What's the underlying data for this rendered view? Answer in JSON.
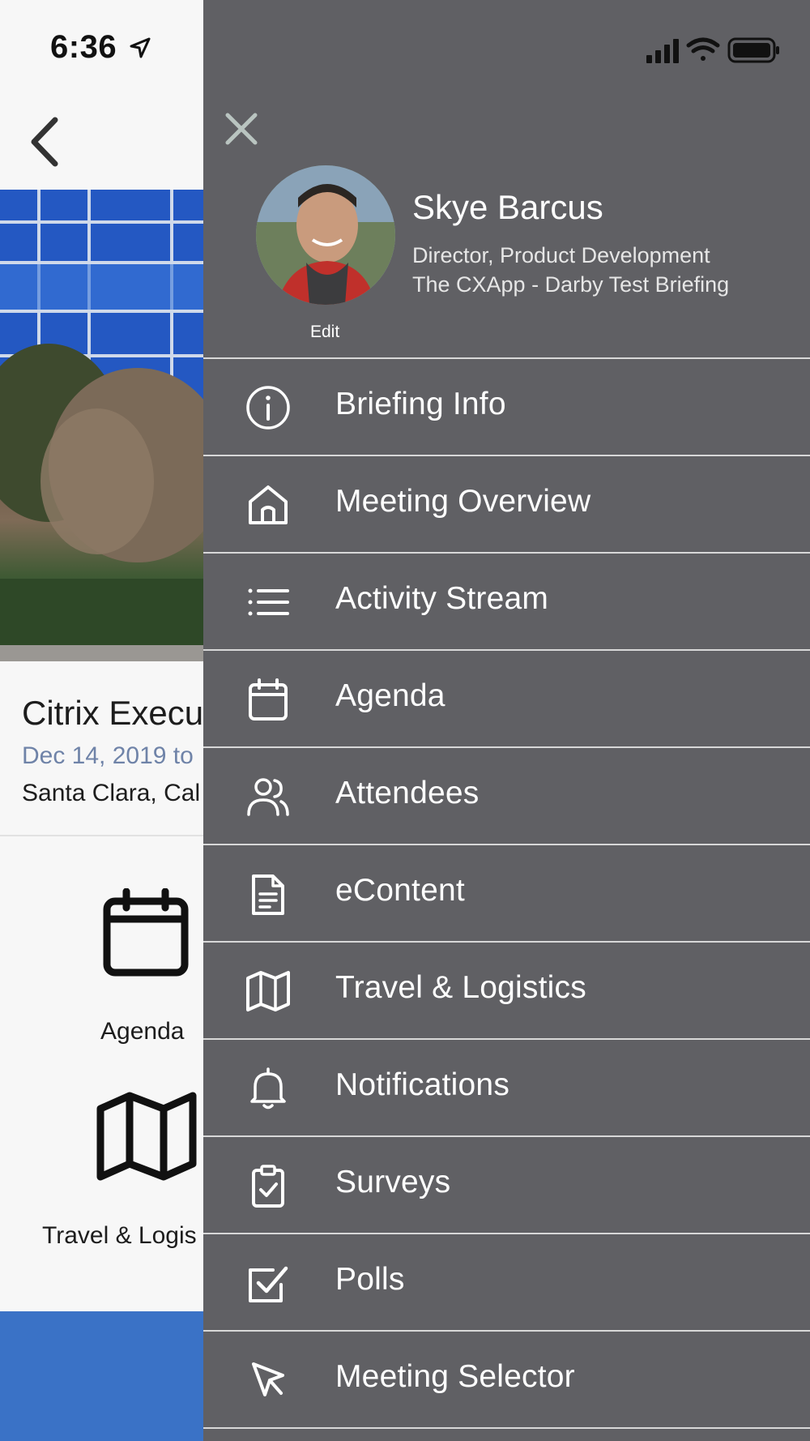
{
  "status_bar": {
    "time": "6:36"
  },
  "background_page": {
    "event_title": "Citrix Execu",
    "event_date": "Dec 14, 2019 to",
    "event_location": "Santa Clara, Cal",
    "tiles": [
      {
        "label": "Agenda",
        "icon": "calendar-icon"
      },
      {
        "label": "Travel & Logis",
        "icon": "map-icon"
      }
    ],
    "colors": {
      "date": "#6f83a8",
      "bottom_bar": "#3a72c6"
    }
  },
  "drawer": {
    "colors": {
      "background": "#606064",
      "divider": "#d8d8d8",
      "text": "#ffffff"
    },
    "profile": {
      "name": "Skye Barcus",
      "title": "Director, Product Development",
      "org": "The CXApp - Darby Test Briefing",
      "edit_label": "Edit"
    },
    "menu": [
      {
        "label": "Briefing Info",
        "icon": "info-icon"
      },
      {
        "label": "Meeting Overview",
        "icon": "home-icon"
      },
      {
        "label": "Activity Stream",
        "icon": "list-icon"
      },
      {
        "label": "Agenda",
        "icon": "calendar-icon"
      },
      {
        "label": "Attendees",
        "icon": "users-icon"
      },
      {
        "label": "eContent",
        "icon": "document-icon"
      },
      {
        "label": "Travel & Logistics",
        "icon": "map-icon"
      },
      {
        "label": "Notifications",
        "icon": "bell-icon"
      },
      {
        "label": "Surveys",
        "icon": "clipboard-check-icon"
      },
      {
        "label": "Polls",
        "icon": "checkbox-icon"
      },
      {
        "label": "Meeting Selector",
        "icon": "cursor-icon"
      }
    ]
  }
}
